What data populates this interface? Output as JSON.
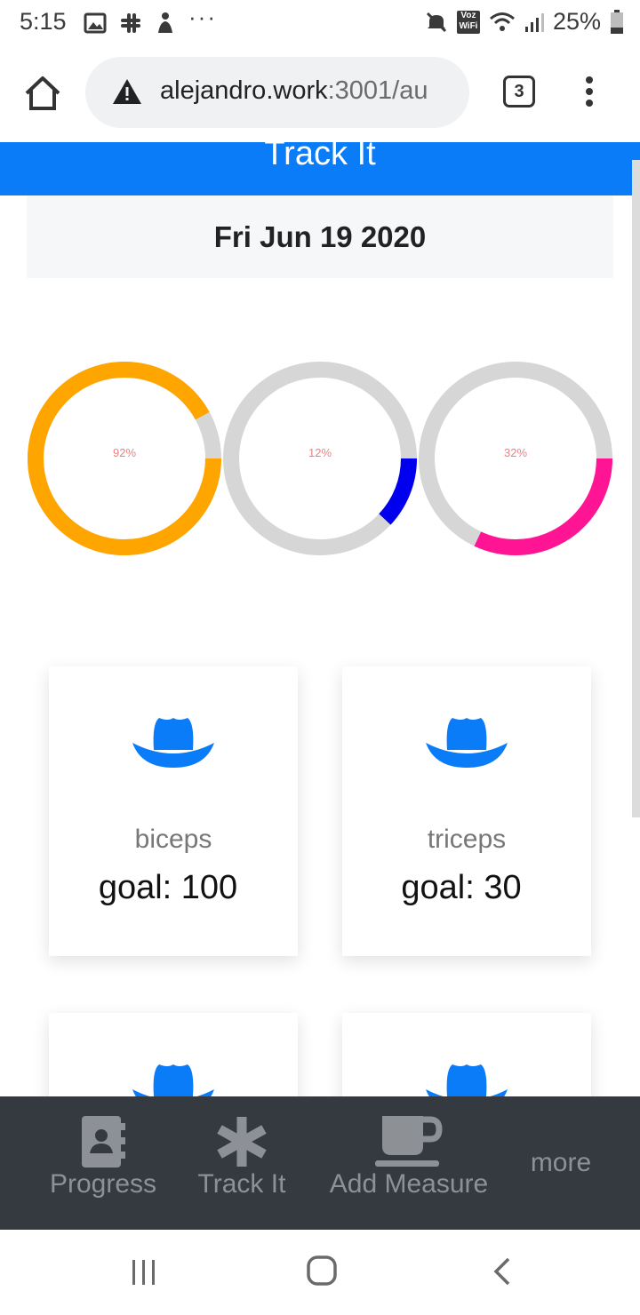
{
  "status_bar": {
    "time": "5:15",
    "battery": "25%",
    "wifi_badge_top": "Voz",
    "wifi_badge_bottom": "WiFi"
  },
  "browser": {
    "url_host": "alejandro.work",
    "url_path": ":3001/au",
    "tab_count": "3"
  },
  "page": {
    "header_title": "Track It",
    "date": "Fri Jun 19 2020"
  },
  "rings": [
    {
      "label": "92%",
      "value": 0.92,
      "color": "#ffa500"
    },
    {
      "label": "12%",
      "value": 0.12,
      "color": "#0000ee"
    },
    {
      "label": "32%",
      "value": 0.32,
      "color": "#ff1493"
    }
  ],
  "colors": {
    "accent": "#0a7cf8",
    "ring_track": "#d6d6d6",
    "nav_bg": "#343a40",
    "ring_label": "#f08080"
  },
  "cards": [
    {
      "icon": "cowboy-hat-icon",
      "name": "biceps",
      "goal": "goal: 100"
    },
    {
      "icon": "cowboy-hat-icon",
      "name": "triceps",
      "goal": "goal: 30"
    },
    {
      "icon": "cowboy-hat-icon",
      "name": "",
      "goal": ""
    },
    {
      "icon": "cowboy-hat-icon",
      "name": "",
      "goal": ""
    }
  ],
  "bottom_nav": {
    "progress": "Progress",
    "track_it": "Track It",
    "add_measure": "Add Measure",
    "more": "more"
  }
}
